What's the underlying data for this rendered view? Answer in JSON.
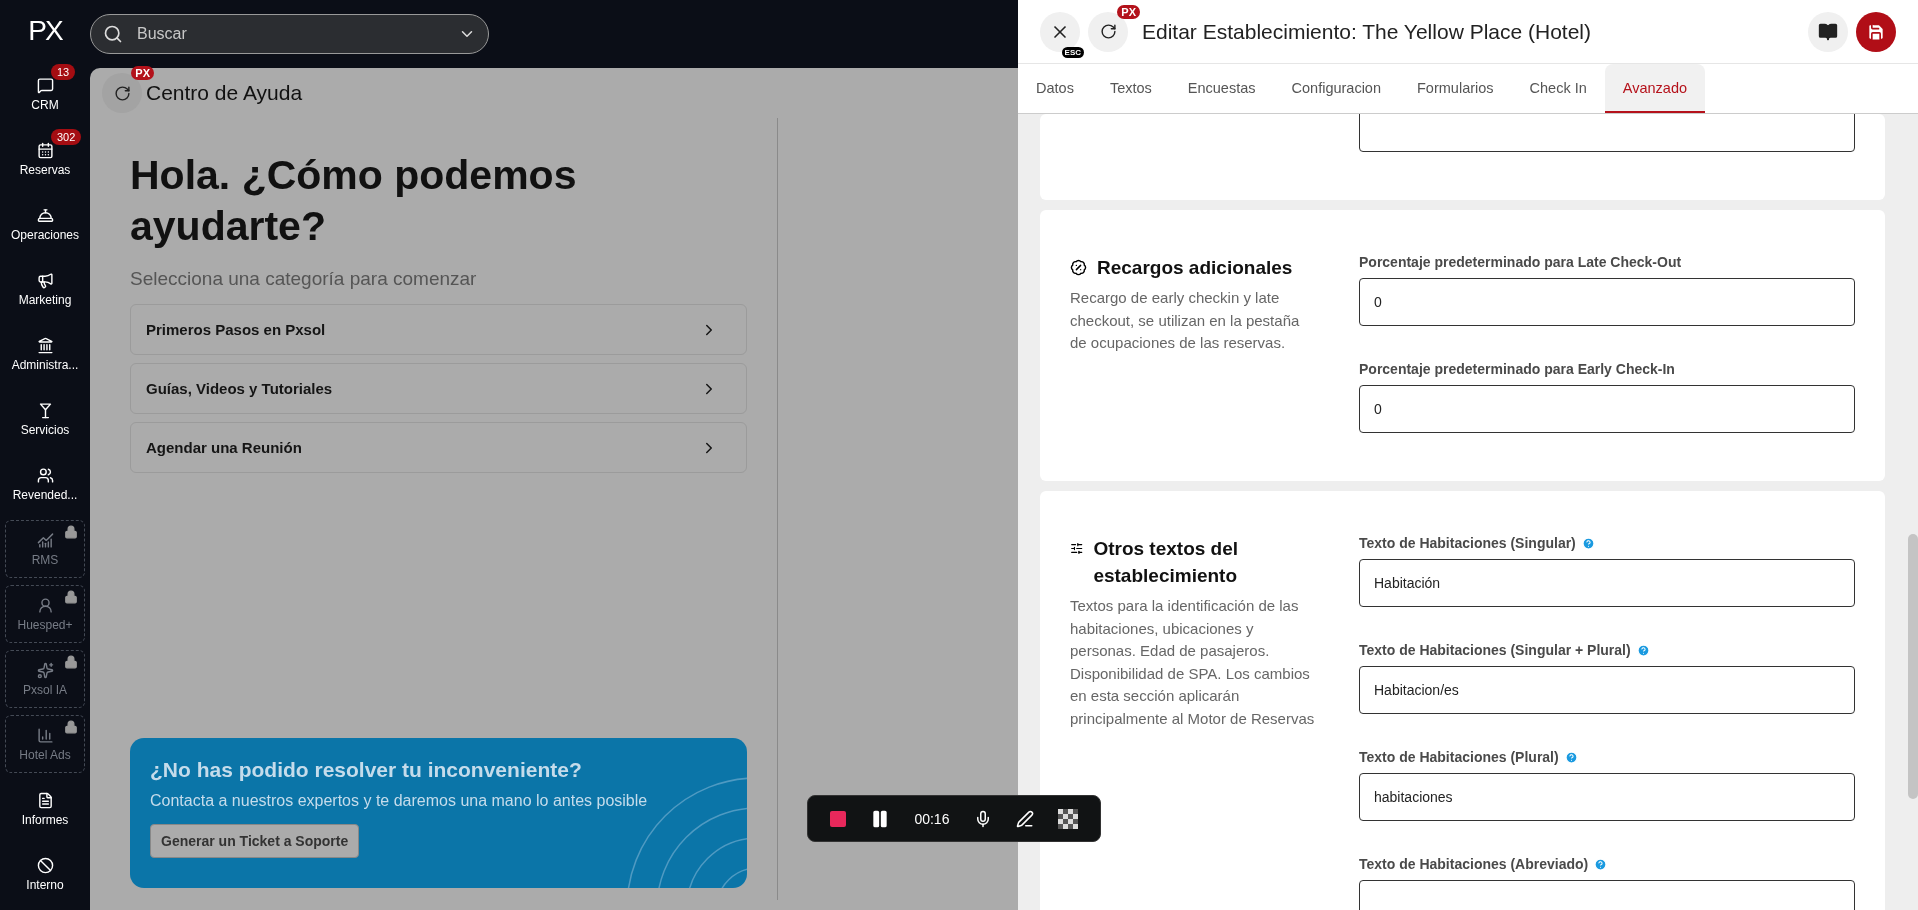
{
  "sidebar": {
    "logo": "PX",
    "items": [
      {
        "kind": "nav",
        "label": "CRM",
        "badge": "13"
      },
      {
        "kind": "nav",
        "label": "Reservas",
        "badge": "302"
      },
      {
        "kind": "nav",
        "label": "Operaciones"
      },
      {
        "kind": "nav",
        "label": "Marketing"
      },
      {
        "kind": "nav",
        "label": "Administra..."
      },
      {
        "kind": "nav",
        "label": "Servicios"
      },
      {
        "kind": "nav",
        "label": "Revended..."
      },
      {
        "kind": "locked",
        "label": "RMS"
      },
      {
        "kind": "locked",
        "label": "Huesped+"
      },
      {
        "kind": "locked",
        "label": "Pxsol IA"
      },
      {
        "kind": "locked",
        "label": "Hotel Ads"
      },
      {
        "kind": "nav",
        "label": "Informes"
      },
      {
        "kind": "nav",
        "label": "Interno"
      }
    ]
  },
  "search": {
    "placeholder": "Buscar"
  },
  "help_center": {
    "title": "Centro de Ayuda",
    "badge": "PX",
    "heading": "Hola. ¿Cómo podemos ayudarte?",
    "subtitle": "Selecciona una categoría para comenzar",
    "categories": [
      "Primeros Pasos en Pxsol",
      "Guías, Videos y Tutoriales",
      "Agendar una Reunión"
    ],
    "support": {
      "title": "¿No has podido resolver tu inconveniente?",
      "text": "Contacta a nuestros expertos y te daremos una mano lo antes posible",
      "button": "Generar un Ticket a Soporte"
    }
  },
  "editor": {
    "close_hint": "ESC",
    "refresh_badge": "PX",
    "title": "Editar Establecimiento: The Yellow Place (Hotel)",
    "tabs": [
      {
        "label": "Datos",
        "selected": false
      },
      {
        "label": "Textos",
        "selected": false
      },
      {
        "label": "Encuestas",
        "selected": false
      },
      {
        "label": "Configuracion",
        "selected": false
      },
      {
        "label": "Formularios",
        "selected": false
      },
      {
        "label": "Check In",
        "selected": false
      },
      {
        "label": "Avanzado",
        "selected": true
      }
    ],
    "cards": [
      {
        "kind": "partial",
        "fields": [
          {
            "kind": "input"
          }
        ]
      },
      {
        "kind": "full",
        "title": "Recargos adicionales",
        "description": "Recargo de early checkin y late checkout, se utilizan en la pestaña de ocupaciones de las reservas.",
        "fields": [
          {
            "label": "Porcentaje predeterminado para Late Check-Out",
            "value": "0",
            "help": false
          },
          {
            "label": "Porcentaje predeterminado para Early Check-In",
            "value": "0",
            "help": false
          }
        ]
      },
      {
        "kind": "full",
        "title": "Otros textos del establecimiento",
        "description": "Textos para la identificación de las habitaciones, ubicaciones y personas. Edad de pasajeros. Disponibilidad de SPA. Los cambios en esta sección aplicarán principalmente al Motor de Reservas",
        "fields": [
          {
            "label": "Texto de Habitaciones (Singular)",
            "value": "Habitación",
            "help": true
          },
          {
            "label": "Texto de Habitaciones (Singular + Plural)",
            "value": "Habitacion/es",
            "help": true
          },
          {
            "label": "Texto de Habitaciones (Plural)",
            "value": "habitaciones",
            "help": true
          },
          {
            "label": "Texto de Habitaciones (Abreviado)",
            "help": true
          }
        ]
      }
    ]
  },
  "recorder": {
    "time": "00:16"
  }
}
